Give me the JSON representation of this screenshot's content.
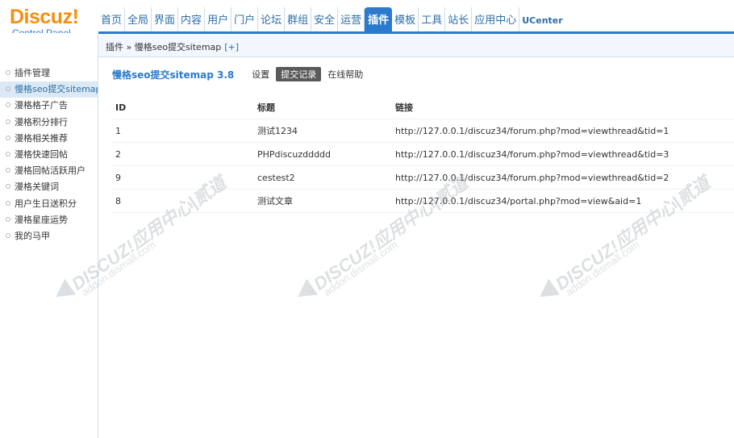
{
  "logo": {
    "main": "Discuz!",
    "sub": "Control Panel"
  },
  "nav": [
    "首页",
    "全局",
    "界面",
    "内容",
    "用户",
    "门户",
    "论坛",
    "群组",
    "安全",
    "运营",
    "插件",
    "模板",
    "工具",
    "站长",
    "应用中心",
    "UCenter"
  ],
  "nav_active": "插件",
  "breadcrumb": {
    "text": "插件 » 慢格seo提交sitemap",
    "plus": "[+]"
  },
  "sidebar": [
    {
      "label": "插件管理"
    },
    {
      "label": "慢格seo提交sitemap",
      "active": true
    },
    {
      "label": "漫格格子广告"
    },
    {
      "label": "漫格积分排行"
    },
    {
      "label": "漫格相关推荐"
    },
    {
      "label": "漫格快速回帖"
    },
    {
      "label": "漫格回帖活跃用户"
    },
    {
      "label": "漫格关键词"
    },
    {
      "label": "用户生日送积分"
    },
    {
      "label": "漫格星座运势"
    },
    {
      "label": "我的马甲"
    }
  ],
  "main": {
    "title": "慢格seo提交sitemap 3.8",
    "tabs": [
      {
        "label": "设置"
      },
      {
        "label": "提交记录",
        "active": true
      },
      {
        "label": "在线帮助"
      }
    ],
    "table": {
      "headers": [
        "ID",
        "标题",
        "链接"
      ],
      "rows": [
        [
          "1",
          "测试1234",
          "http://127.0.0.1/discuz34/forum.php?mod=viewthread&tid=1"
        ],
        [
          "2",
          "PHPdiscuzddddd",
          "http://127.0.0.1/discuz34/forum.php?mod=viewthread&tid=3"
        ],
        [
          "9",
          "cestest2",
          "http://127.0.0.1/discuz34/forum.php?mod=viewthread&tid=2"
        ],
        [
          "8",
          "测试文章",
          "http://127.0.0.1/discuz34/portal.php?mod=view&aid=1"
        ]
      ]
    }
  },
  "watermark": {
    "text": "DISCUZ!应用中心|贰道",
    "sub": "addon.dismall.com"
  }
}
